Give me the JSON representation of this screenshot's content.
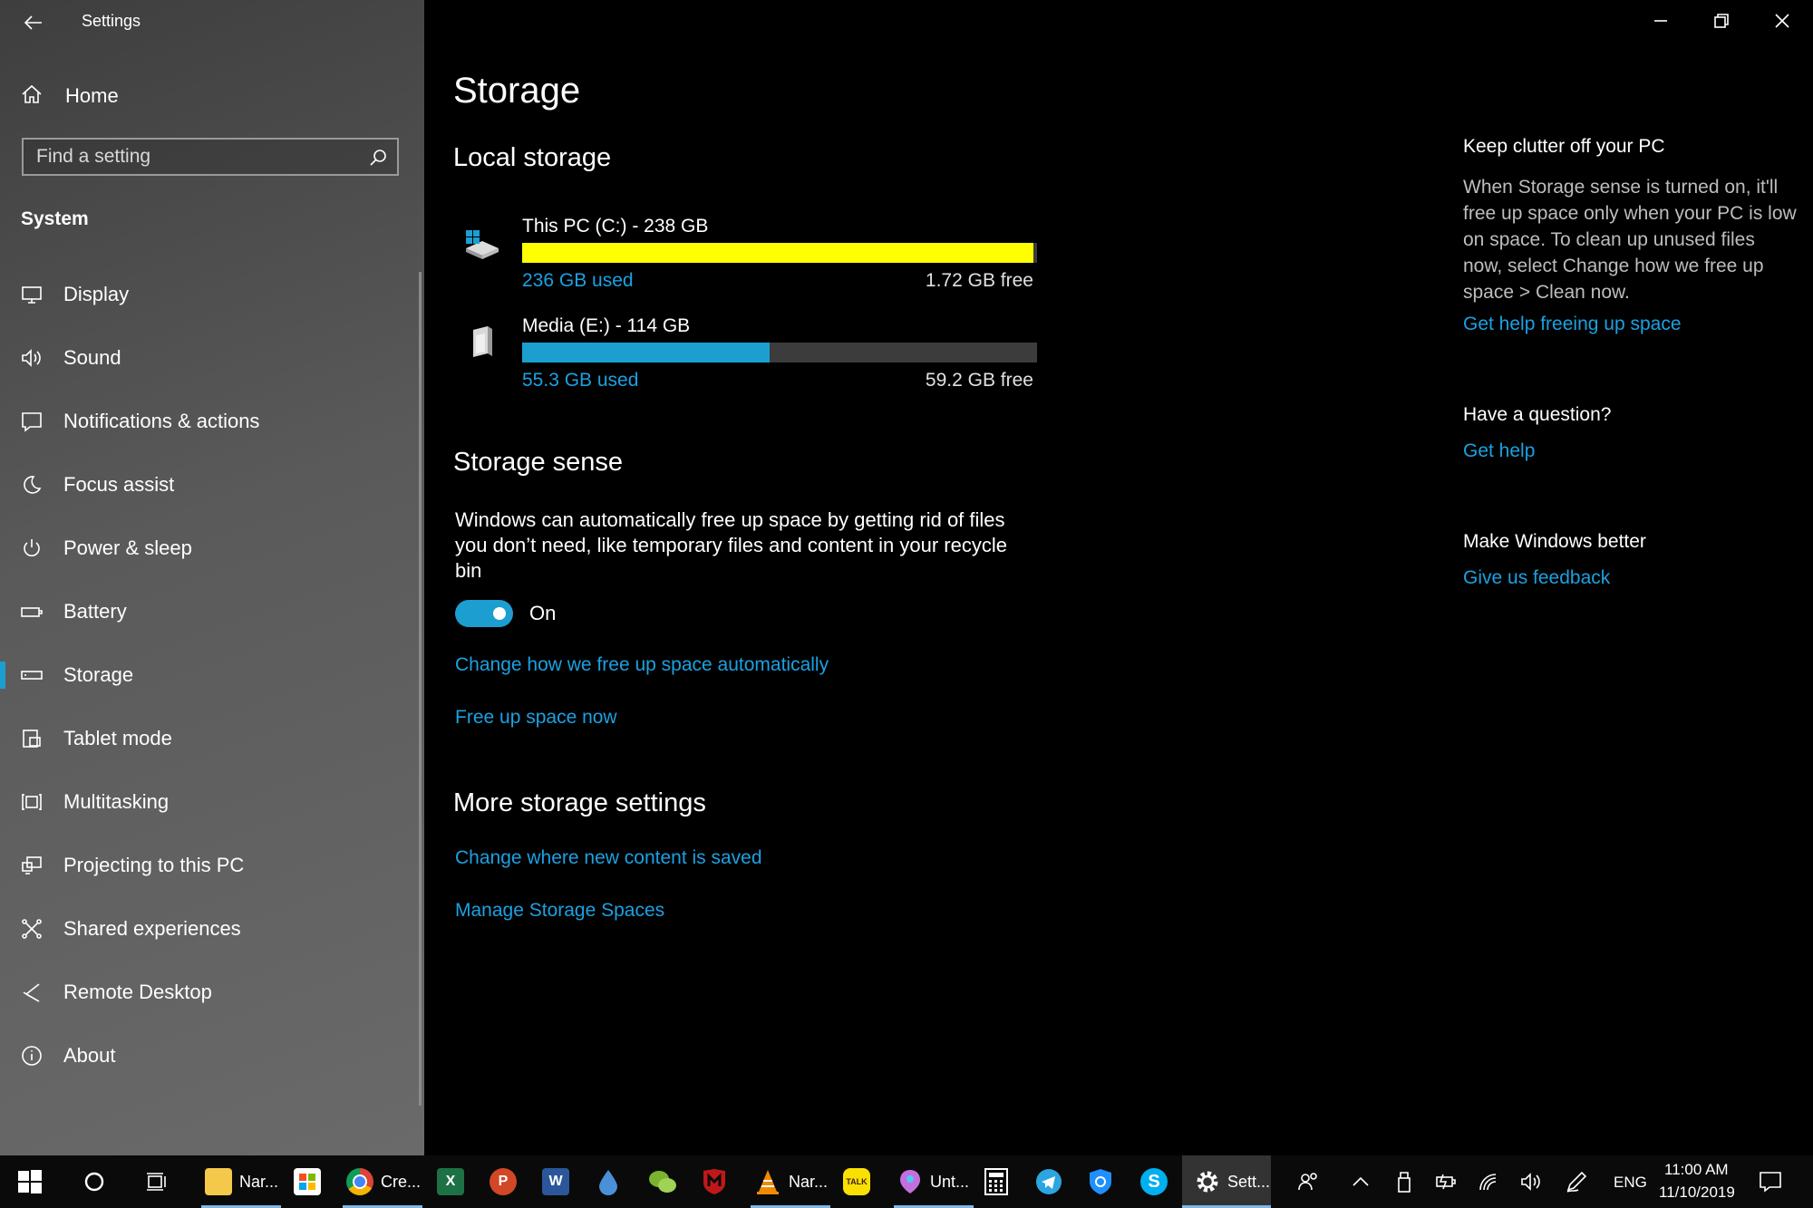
{
  "window": {
    "title": "Settings"
  },
  "sidebar": {
    "home": "Home",
    "search_placeholder": "Find a setting",
    "section": "System",
    "items": [
      {
        "label": "Display",
        "icon": "monitor-icon"
      },
      {
        "label": "Sound",
        "icon": "speaker-icon"
      },
      {
        "label": "Notifications & actions",
        "icon": "notification-icon"
      },
      {
        "label": "Focus assist",
        "icon": "moon-icon"
      },
      {
        "label": "Power & sleep",
        "icon": "power-icon"
      },
      {
        "label": "Battery",
        "icon": "battery-icon"
      },
      {
        "label": "Storage",
        "icon": "storage-icon",
        "active": true
      },
      {
        "label": "Tablet mode",
        "icon": "tablet-icon"
      },
      {
        "label": "Multitasking",
        "icon": "multitasking-icon"
      },
      {
        "label": "Projecting to this PC",
        "icon": "projecting-icon"
      },
      {
        "label": "Shared experiences",
        "icon": "shared-icon"
      },
      {
        "label": "Remote Desktop",
        "icon": "remote-desktop-icon"
      },
      {
        "label": "About",
        "icon": "info-icon"
      }
    ]
  },
  "main": {
    "title": "Storage",
    "local_storage": {
      "heading": "Local storage",
      "drives": [
        {
          "name": "This PC (C:) - 238 GB",
          "used": "236 GB used",
          "free": "1.72 GB free",
          "fraction_used": 0.993,
          "color": "#ffff00"
        },
        {
          "name": "Media (E:) - 114 GB",
          "used": "55.3 GB used",
          "free": "59.2 GB free",
          "fraction_used": 0.48,
          "color": "#1d9ed0"
        }
      ]
    },
    "storage_sense": {
      "heading": "Storage sense",
      "description": "Windows can automatically free up space by getting rid of files you don’t need, like temporary files and content in your recycle bin",
      "toggle_state": "On",
      "link_change": "Change how we free up space automatically",
      "link_free_now": "Free up space now"
    },
    "more": {
      "heading": "More storage settings",
      "link_content": "Change where new content is saved",
      "link_spaces": "Manage Storage Spaces"
    }
  },
  "right_panel": {
    "clutter_heading": "Keep clutter off your PC",
    "clutter_text": "When Storage sense is turned on, it'll free up space only when your PC is low on space. To clean up unused files now, select Change how we free up space > Clean now.",
    "clutter_link": "Get help freeing up space",
    "question_heading": "Have a question?",
    "question_link": "Get help",
    "better_heading": "Make Windows better",
    "better_link": "Give us feedback"
  },
  "taskbar": {
    "apps": [
      {
        "label": "Nar...",
        "icon": "file-explorer-icon"
      },
      {
        "label": "",
        "icon": "store-icon"
      },
      {
        "label": "Cre...",
        "icon": "chrome-icon"
      },
      {
        "label": "",
        "icon": "excel-icon"
      },
      {
        "label": "",
        "icon": "powerpoint-icon"
      },
      {
        "label": "",
        "icon": "word-icon"
      },
      {
        "label": "",
        "icon": "drop-icon"
      },
      {
        "label": "",
        "icon": "wechat-icon"
      },
      {
        "label": "",
        "icon": "mcafee-icon"
      },
      {
        "label": "Nar...",
        "icon": "vlc-icon"
      },
      {
        "label": "",
        "icon": "kakaotalk-icon"
      },
      {
        "label": "Unt...",
        "icon": "paint3d-icon"
      },
      {
        "label": "",
        "icon": "calculator-icon"
      },
      {
        "label": "",
        "icon": "telegram-icon"
      },
      {
        "label": "",
        "icon": "defender-icon"
      },
      {
        "label": "",
        "icon": "skype-icon"
      },
      {
        "label": "Sett...",
        "icon": "settings-gear-icon"
      }
    ],
    "language": "ENG",
    "time": "11:00 AM",
    "date": "11/10/2019",
    "excel_letter": "X",
    "powerpoint_letter": "P",
    "word_letter": "W",
    "kakao_letter": "TALK",
    "skype_letter": "S"
  }
}
